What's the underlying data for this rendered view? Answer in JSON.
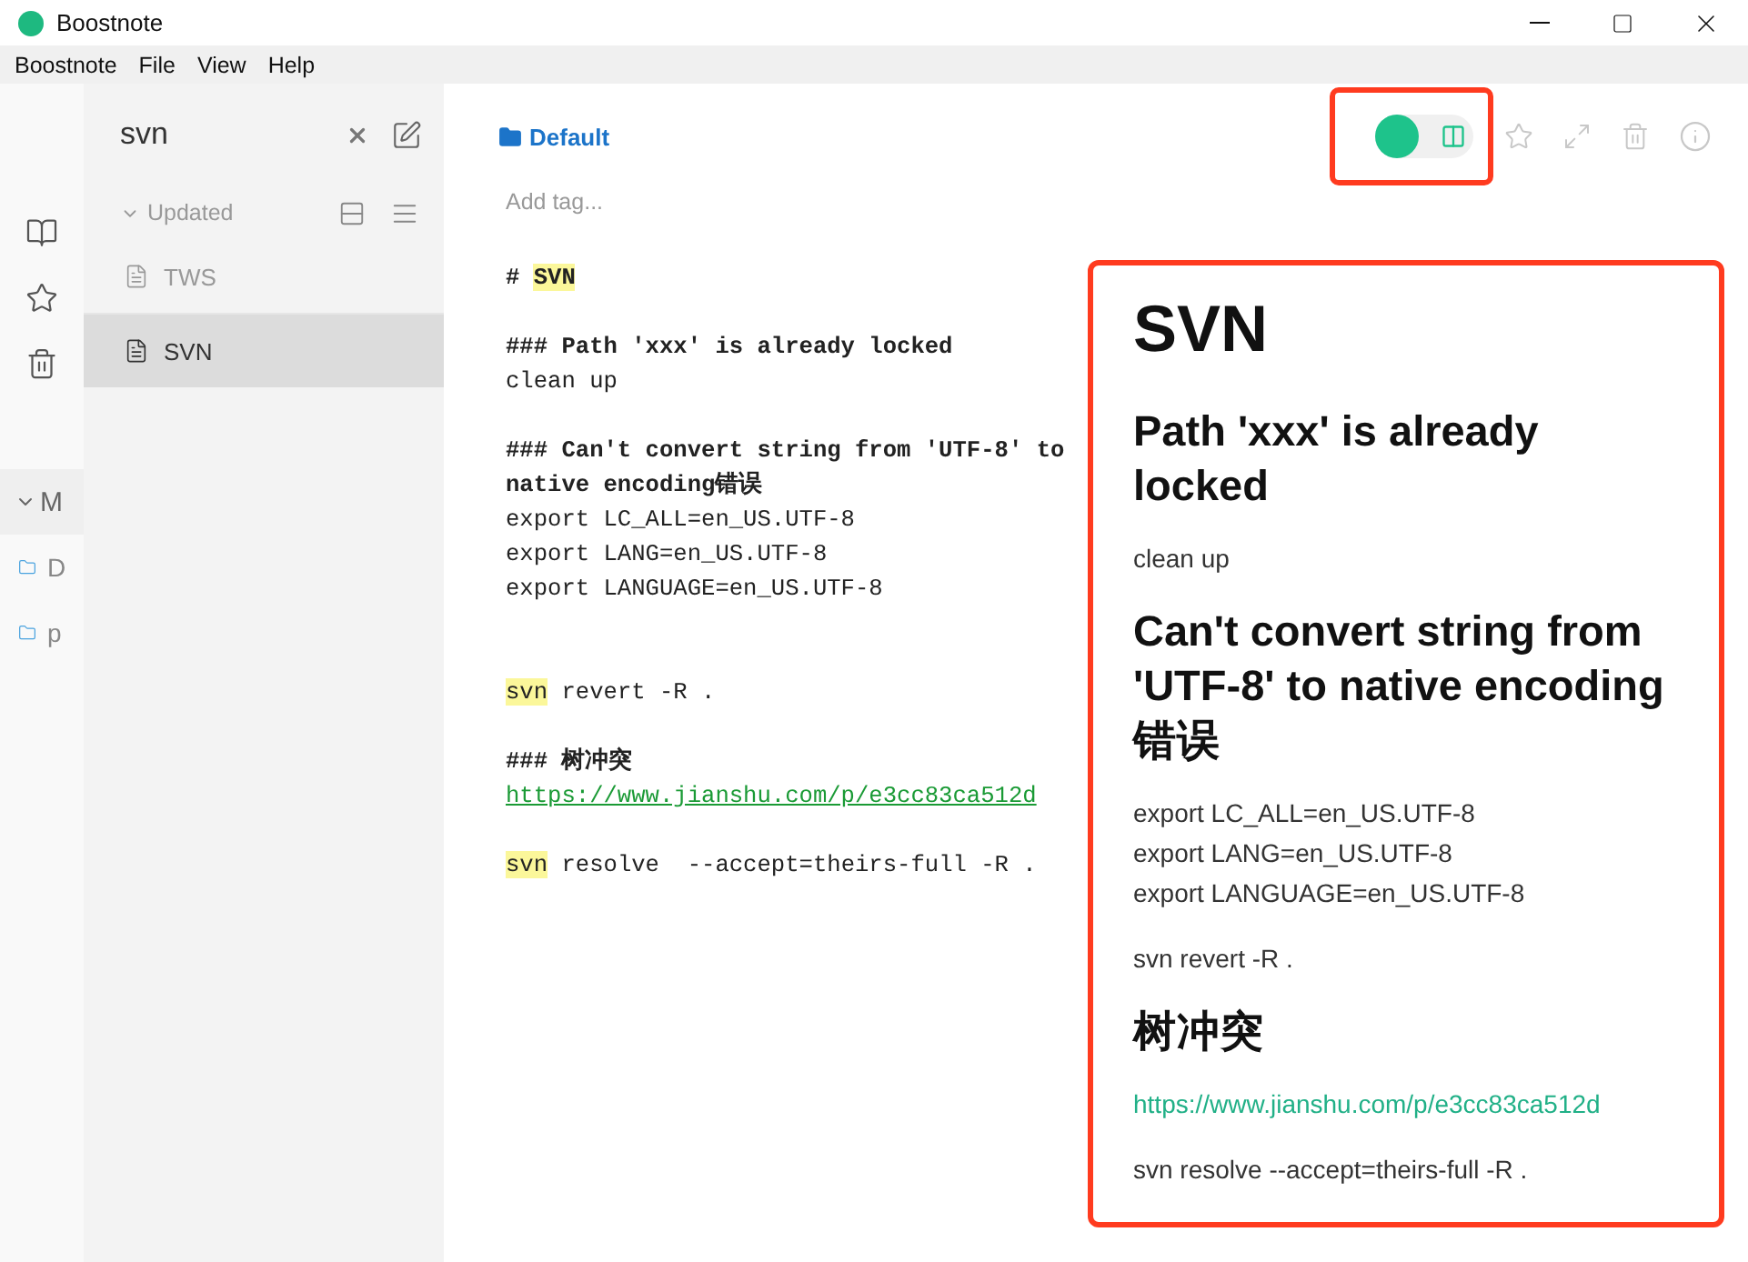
{
  "window": {
    "title": "Boostnote"
  },
  "menu": [
    "Boostnote",
    "File",
    "View",
    "Help"
  ],
  "rail": {
    "storage": {
      "label": "M",
      "expanded": true
    },
    "folders": [
      "D",
      "p"
    ]
  },
  "note_list": {
    "search": "svn",
    "sort": "Updated",
    "notes": [
      {
        "title": "TWS",
        "selected": false
      },
      {
        "title": "SVN",
        "selected": true
      }
    ]
  },
  "editor": {
    "folder": "Default",
    "tag_placeholder": "Add tag...",
    "split_view": true,
    "lines": [
      {
        "kind": "heading",
        "segments": [
          {
            "text": "# ",
            "marked": false
          },
          {
            "text": "SVN",
            "marked": true
          }
        ]
      },
      {
        "kind": "blank"
      },
      {
        "kind": "heading",
        "segments": [
          {
            "text": "### Path 'xxx' is already locked",
            "marked": false
          }
        ]
      },
      {
        "kind": "code",
        "segments": [
          {
            "text": "clean up",
            "marked": false
          }
        ]
      },
      {
        "kind": "blank"
      },
      {
        "kind": "heading",
        "segments": [
          {
            "text": "### Can't convert string from 'UTF-8' to",
            "marked": false
          }
        ]
      },
      {
        "kind": "heading",
        "segments": [
          {
            "text": "native encoding错误",
            "marked": false
          }
        ]
      },
      {
        "kind": "code",
        "segments": [
          {
            "text": "export LC_ALL=en_US.UTF-8",
            "marked": false
          }
        ]
      },
      {
        "kind": "code",
        "segments": [
          {
            "text": "export LANG=en_US.UTF-8",
            "marked": false
          }
        ]
      },
      {
        "kind": "code",
        "segments": [
          {
            "text": "export LANGUAGE=en_US.UTF-8",
            "marked": false
          }
        ]
      },
      {
        "kind": "blank"
      },
      {
        "kind": "blank"
      },
      {
        "kind": "code",
        "segments": [
          {
            "text": "svn",
            "marked": true
          },
          {
            "text": " revert -R .",
            "marked": false
          }
        ]
      },
      {
        "kind": "blank"
      },
      {
        "kind": "heading",
        "segments": [
          {
            "text": "### 树冲突",
            "marked": false
          }
        ]
      },
      {
        "kind": "link",
        "segments": [
          {
            "text": "https://www.jianshu.com/p/e3cc83ca512d",
            "marked": false
          }
        ]
      },
      {
        "kind": "blank"
      },
      {
        "kind": "code",
        "segments": [
          {
            "text": "svn",
            "marked": true
          },
          {
            "text": " resolve  --accept=theirs-full -R .",
            "marked": false
          }
        ]
      }
    ]
  },
  "preview": {
    "blocks": [
      {
        "kind": "h1",
        "text": "SVN"
      },
      {
        "kind": "h3",
        "text": "Path 'xxx' is already locked"
      },
      {
        "kind": "p",
        "lines": [
          "clean up"
        ]
      },
      {
        "kind": "h3",
        "text": "Can't convert string from 'UTF-8' to native encoding错误"
      },
      {
        "kind": "p",
        "lines": [
          "export LC_ALL=en_US.UTF-8",
          "export LANG=en_US.UTF-8",
          "export LANGUAGE=en_US.UTF-8"
        ]
      },
      {
        "kind": "p",
        "lines": [
          "svn revert -R ."
        ]
      },
      {
        "kind": "h3",
        "text": "树冲突"
      },
      {
        "kind": "link",
        "text": "https://www.jianshu.com/p/e3cc83ca512d"
      },
      {
        "kind": "p",
        "lines": [
          "svn resolve --accept=theirs-full -R ."
        ]
      }
    ]
  }
}
